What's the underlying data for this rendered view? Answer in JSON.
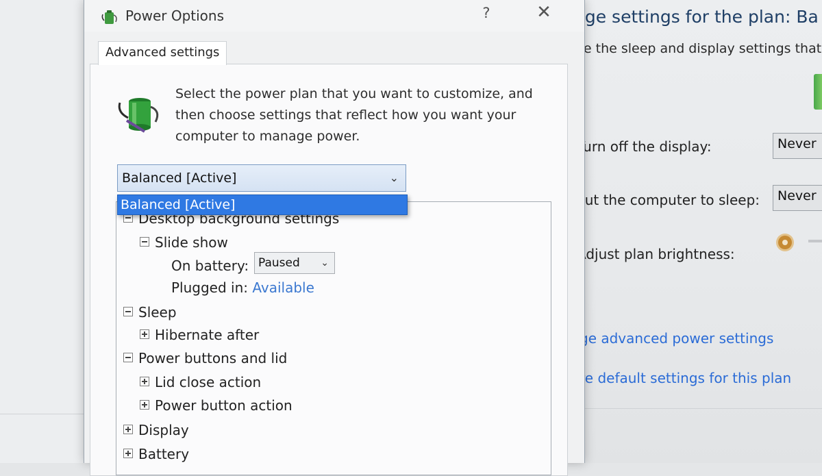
{
  "background_window": {
    "heading": "nge settings for the plan: Ba",
    "subtitle": "se the sleep and display settings that",
    "rows": [
      {
        "label": "Turn off the display:",
        "value": "Never"
      },
      {
        "label": "Put the computer to sleep:",
        "value": "Never"
      },
      {
        "label": "Adjust plan brightness:"
      }
    ],
    "links": [
      "ge advanced power settings",
      "re default settings for this plan"
    ]
  },
  "dialog": {
    "title": "Power Options",
    "help_label": "?",
    "close_label": "✕",
    "tab_label": "Advanced settings",
    "intro_text": "Select the power plan that you want to customize, and then choose settings that reflect how you want your computer to manage power.",
    "plan_select": {
      "value": "Balanced [Active]",
      "options": [
        "Balanced [Active]"
      ]
    },
    "tree": {
      "desktop_background": "Desktop background settings",
      "slide_show": "Slide show",
      "on_battery_label": "On battery:",
      "on_battery_value": "Paused",
      "plugged_in_label": "Plugged in:",
      "plugged_in_value": "Available",
      "sleep": "Sleep",
      "hibernate_after": "Hibernate after",
      "power_buttons": "Power buttons and lid",
      "lid_close": "Lid close action",
      "power_button_action": "Power button action",
      "display": "Display",
      "battery": "Battery"
    }
  },
  "icons": {
    "title": "power-plan-icon",
    "plan": "battery-plug-icon",
    "brightness": "brightness-icon",
    "dropdown": "chevron-down-icon"
  }
}
